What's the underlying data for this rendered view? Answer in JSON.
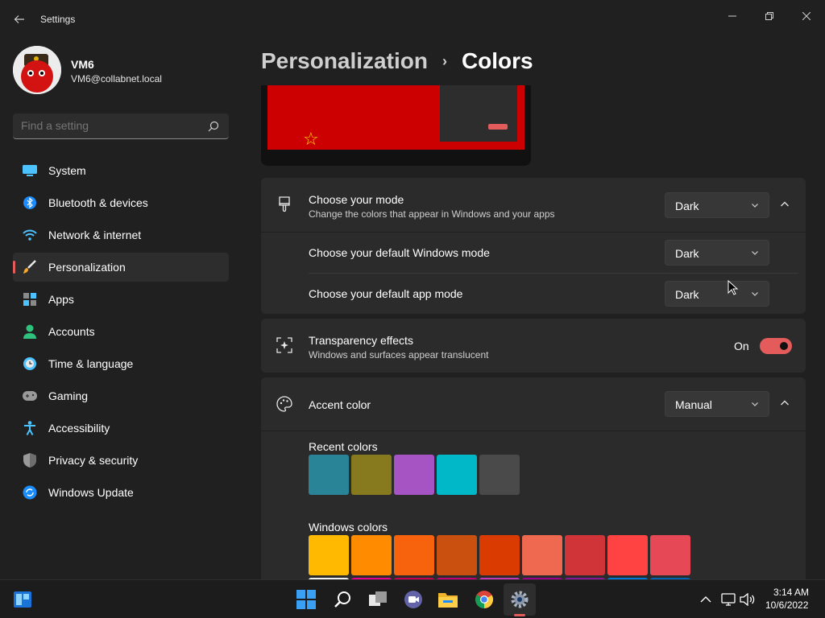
{
  "window": {
    "title": "Settings"
  },
  "profile": {
    "name": "VM6",
    "email": "VM6@collabnet.local"
  },
  "search": {
    "placeholder": "Find a setting"
  },
  "nav": {
    "items": [
      {
        "label": "System",
        "icon": "monitor-icon"
      },
      {
        "label": "Bluetooth & devices",
        "icon": "bluetooth-icon"
      },
      {
        "label": "Network & internet",
        "icon": "wifi-icon"
      },
      {
        "label": "Personalization",
        "icon": "paintbrush-icon",
        "active": true
      },
      {
        "label": "Apps",
        "icon": "apps-icon"
      },
      {
        "label": "Accounts",
        "icon": "person-icon"
      },
      {
        "label": "Time & language",
        "icon": "clock-globe-icon"
      },
      {
        "label": "Gaming",
        "icon": "gamepad-icon"
      },
      {
        "label": "Accessibility",
        "icon": "accessibility-icon"
      },
      {
        "label": "Privacy & security",
        "icon": "shield-icon"
      },
      {
        "label": "Windows Update",
        "icon": "update-icon"
      }
    ]
  },
  "breadcrumb": {
    "parent": "Personalization",
    "separator": "›",
    "current": "Colors"
  },
  "mode_card": {
    "title": "Choose your mode",
    "description": "Change the colors that appear in Windows and your apps",
    "value": "Dark",
    "windows_mode": {
      "label": "Choose your default Windows mode",
      "value": "Dark"
    },
    "app_mode": {
      "label": "Choose your default app mode",
      "value": "Dark"
    }
  },
  "transparency": {
    "title": "Transparency effects",
    "description": "Windows and surfaces appear translucent",
    "state": "On"
  },
  "accent": {
    "title": "Accent color",
    "value": "Manual",
    "recent_label": "Recent colors",
    "recent_colors": [
      "#2a8497",
      "#877a1e",
      "#a653c4",
      "#00b8c8",
      "#4a4a4a"
    ],
    "windows_label": "Windows colors",
    "windows_colors": [
      "#ffb900",
      "#ff8c00",
      "#f7630c",
      "#ca5010",
      "#da3b01",
      "#ef6950",
      "#d13438",
      "#ff4343",
      "#e74856"
    ],
    "windows_colors_row2": [
      "#f0f0f0",
      "#e3008c",
      "#c30052",
      "#bf0077",
      "#c239b3",
      "#9a0089",
      "#881798",
      "#0078d7",
      "#0063b1"
    ]
  },
  "taskbar": {
    "time": "3:14 AM",
    "date": "10/6/2022",
    "apps": [
      "start-icon",
      "search-icon",
      "task-view-icon",
      "teams-chat-icon",
      "file-explorer-icon",
      "chrome-icon",
      "settings-icon"
    ]
  },
  "colors": {
    "accent": "#e35b5b",
    "background": "#202020",
    "card": "#2b2b2b"
  }
}
